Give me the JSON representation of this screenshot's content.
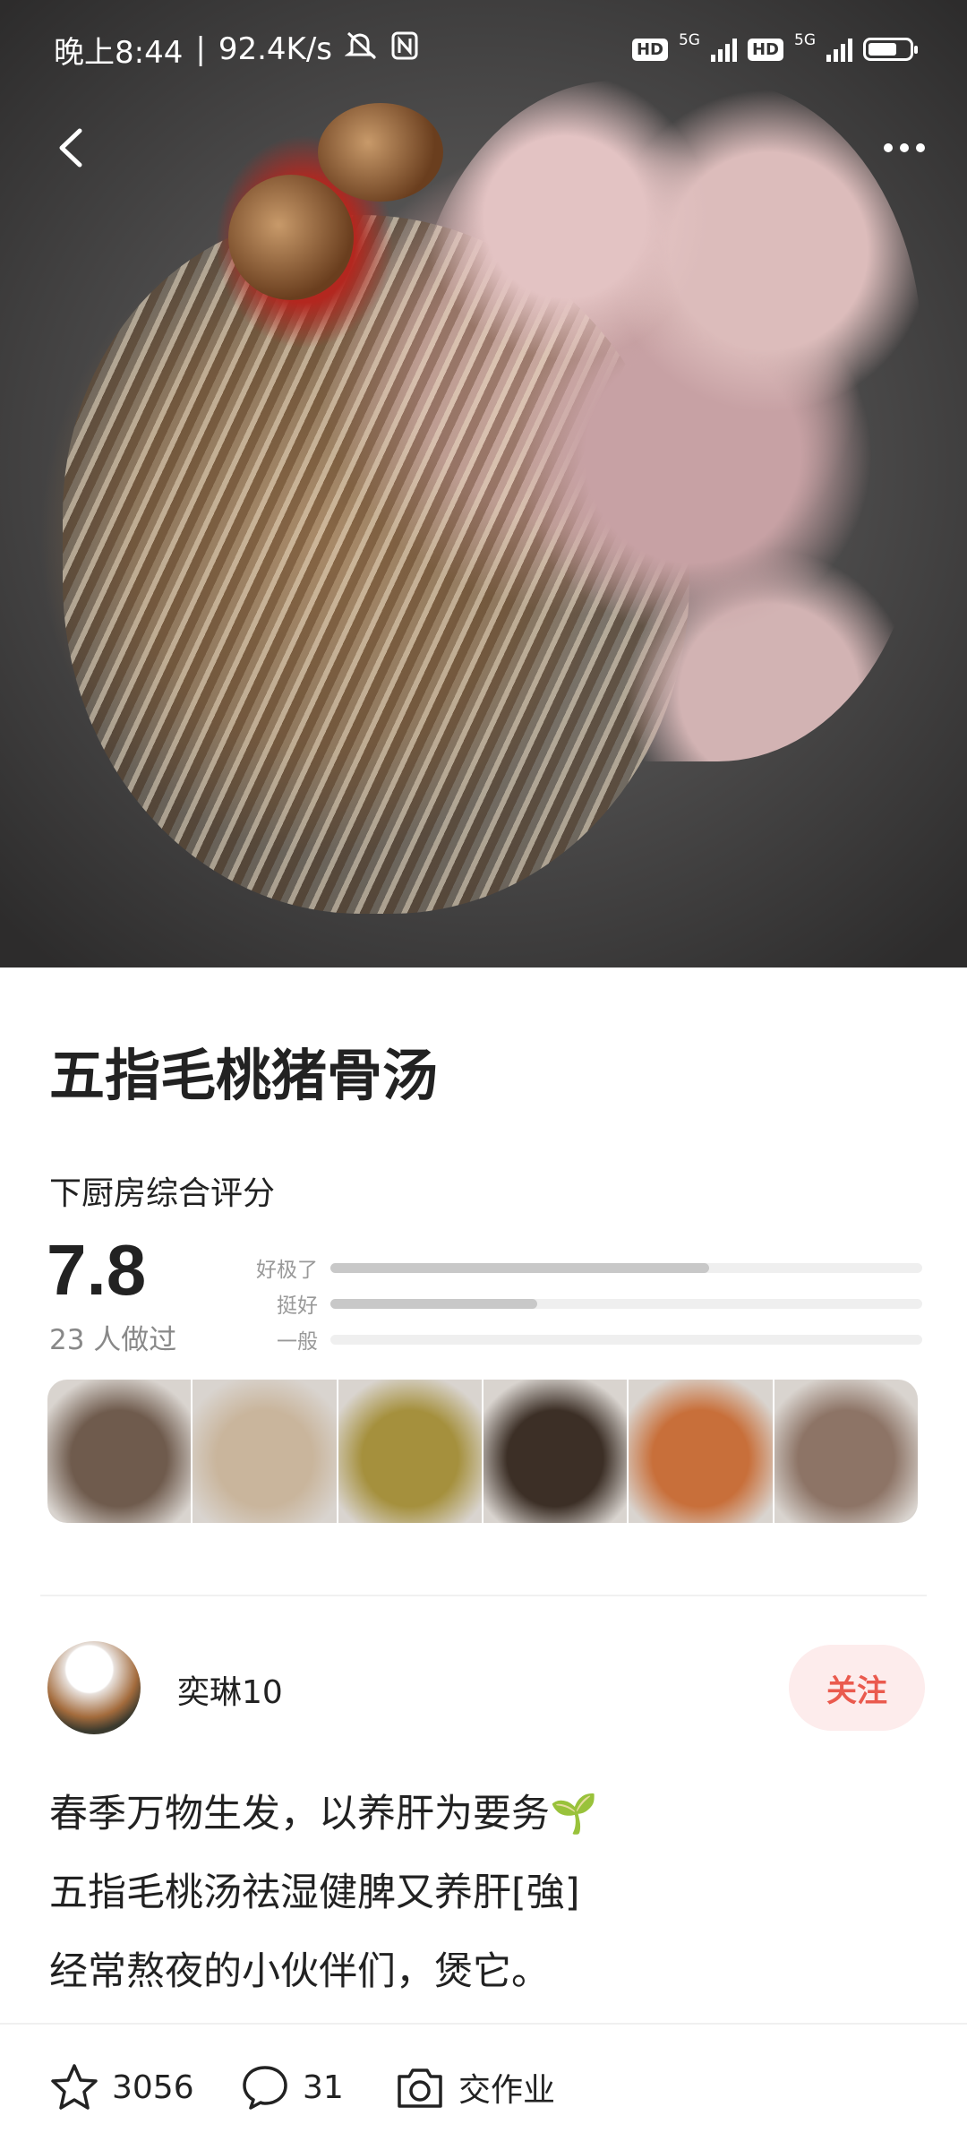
{
  "status_bar": {
    "time": "晚上8:44",
    "speed": "92.4K/s",
    "sim1_hd": "HD",
    "sim1_net": "5G",
    "sim2_hd": "HD",
    "sim2_net": "5G",
    "battery_level": 0.7
  },
  "nav": {
    "back_icon": "chevron-left-icon",
    "more_icon": "more-horizontal-icon"
  },
  "recipe": {
    "title": "五指毛桃猪骨汤"
  },
  "rating": {
    "label": "下厨房综合评分",
    "score": "7.8",
    "made_count": "23 人做过",
    "bars": [
      {
        "label": "好极了",
        "fraction": 0.64
      },
      {
        "label": "挺好",
        "fraction": 0.35
      },
      {
        "label": "一般",
        "fraction": 0.0
      }
    ]
  },
  "thumbnails": [
    {
      "color": "#6f5b4d"
    },
    {
      "color": "#c9b59c"
    },
    {
      "color": "#a5903d"
    },
    {
      "color": "#3c2f26"
    },
    {
      "color": "#c86f3a"
    },
    {
      "color": "#8d7466"
    }
  ],
  "author": {
    "name": "奕琳10",
    "follow_label": "关注"
  },
  "description": [
    "春季万物生发，以养肝为要务🌱",
    "五指毛桃汤祛湿健脾又养肝[強]",
    "经常熬夜的小伙伴们，煲它。"
  ],
  "actions": {
    "favorite_count": "3056",
    "comment_count": "31",
    "homework_label": "交作业"
  }
}
